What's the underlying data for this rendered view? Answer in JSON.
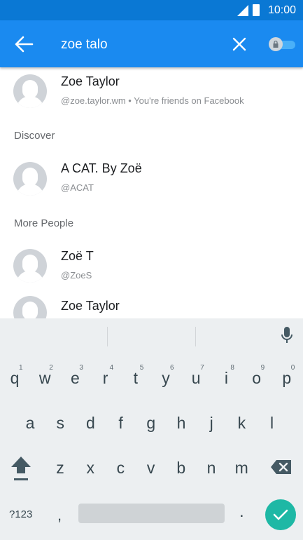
{
  "status_bar": {
    "time": "10:00"
  },
  "search": {
    "query": "zoe talo",
    "back_icon": "arrow-left-icon",
    "clear_icon": "close-icon",
    "toggle_icon": "lock-toggle-icon"
  },
  "results": {
    "top": {
      "name": "Zoe Taylor",
      "sub": "@zoe.taylor.wm • You're friends on Facebook"
    },
    "discover_header": "Discover",
    "discover": {
      "name": "A CAT. By Zoë",
      "sub": "@ACAT"
    },
    "more_header": "More People",
    "more": [
      {
        "name": "Zoë T",
        "sub": "@ZoeS"
      },
      {
        "name": "Zoe Taylor",
        "sub": ""
      }
    ]
  },
  "keyboard": {
    "row1": [
      {
        "key": "q",
        "hint": "1"
      },
      {
        "key": "w",
        "hint": "2"
      },
      {
        "key": "e",
        "hint": "3"
      },
      {
        "key": "r",
        "hint": "4"
      },
      {
        "key": "t",
        "hint": "5"
      },
      {
        "key": "y",
        "hint": "6"
      },
      {
        "key": "u",
        "hint": "7"
      },
      {
        "key": "i",
        "hint": "8"
      },
      {
        "key": "o",
        "hint": "9"
      },
      {
        "key": "p",
        "hint": "0"
      }
    ],
    "row2": [
      "a",
      "s",
      "d",
      "f",
      "g",
      "h",
      "j",
      "k",
      "l"
    ],
    "row3": [
      "z",
      "x",
      "c",
      "v",
      "b",
      "n",
      "m"
    ],
    "symbols_label": "?123",
    "comma": ",",
    "period": ".",
    "accent_color": "#1eb8a5"
  },
  "colors": {
    "appbar": "#1a8af0",
    "statusbar": "#0a78d4"
  }
}
